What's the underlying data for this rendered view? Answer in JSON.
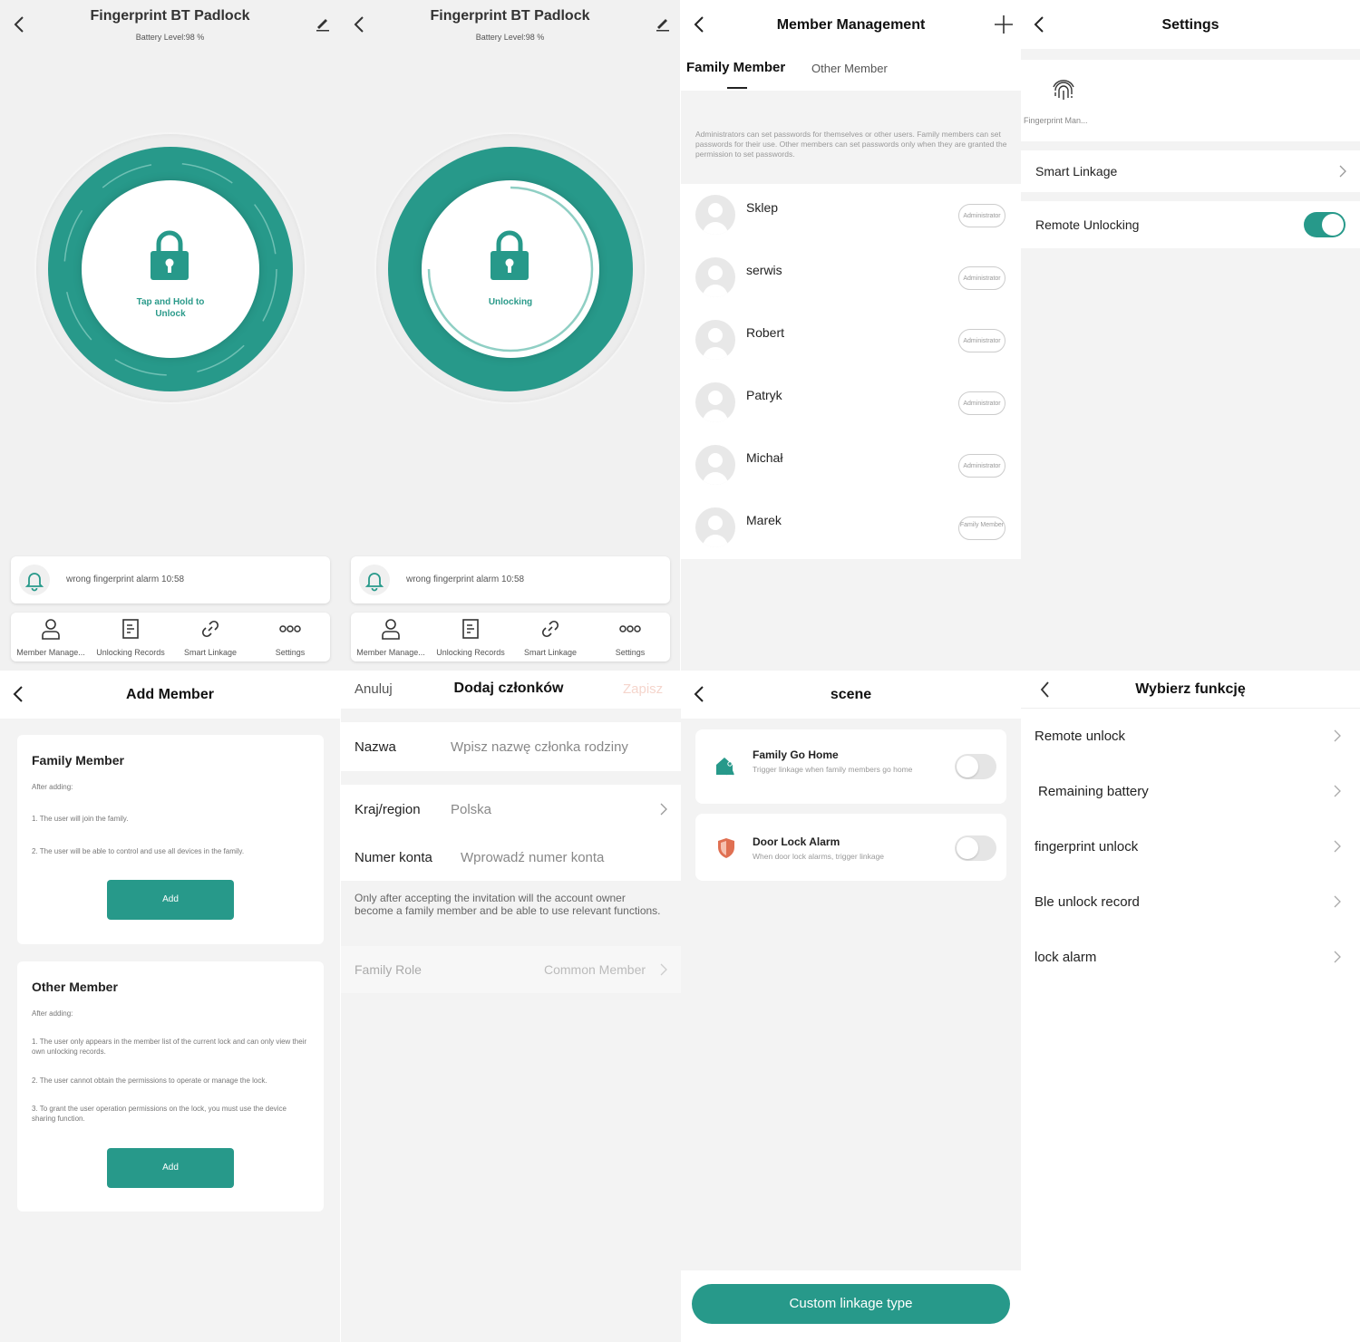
{
  "colors": {
    "accent": "#27998a",
    "background": "#f1f1f1",
    "danger": "#e07052"
  },
  "lock_screen_1": {
    "title": "Fingerprint BT Padlock",
    "battery": "Battery Level:98 %",
    "button_line1": "Tap and Hold to",
    "button_line2": "Unlock",
    "alarm": "wrong fingerprint alarm 10:58",
    "tabs": [
      {
        "label": "Member Manage...",
        "icon": "person-icon"
      },
      {
        "label": "Unlocking Records",
        "icon": "records-icon"
      },
      {
        "label": "Smart Linkage",
        "icon": "link-icon"
      },
      {
        "label": "Settings",
        "icon": "more-icon"
      }
    ]
  },
  "lock_screen_2": {
    "title": "Fingerprint BT Padlock",
    "battery": "Battery Level:98 %",
    "status": "Unlocking",
    "alarm": "wrong fingerprint alarm 10:58",
    "tabs": [
      {
        "label": "Member Manage...",
        "icon": "person-icon"
      },
      {
        "label": "Unlocking Records",
        "icon": "records-icon"
      },
      {
        "label": "Smart Linkage",
        "icon": "link-icon"
      },
      {
        "label": "Settings",
        "icon": "more-icon"
      }
    ]
  },
  "member_management": {
    "title": "Member Management",
    "tab_family": "Family Member",
    "tab_other": "Other Member",
    "info": "Administrators can set passwords for themselves or other users. Family members can set passwords for their use. Other members can set passwords only when they are granted the permission to set passwords.",
    "members": [
      {
        "name": "Sklep",
        "role": "Administrator"
      },
      {
        "name": "serwis",
        "role": "Administrator"
      },
      {
        "name": "Robert",
        "role": "Administrator"
      },
      {
        "name": "Patryk",
        "role": "Administrator"
      },
      {
        "name": "Michał",
        "role": "Administrator"
      },
      {
        "name": "Marek",
        "role": "Family Member"
      }
    ]
  },
  "settings": {
    "title": "Settings",
    "fingerprint_label": "Fingerprint Man...",
    "smart_linkage": "Smart Linkage",
    "remote_unlocking": "Remote Unlocking",
    "remote_unlocking_on": true
  },
  "add_member": {
    "title": "Add Member",
    "family": {
      "heading": "Family Member",
      "after": "After adding:",
      "points": [
        "1. The user will join the family.",
        "2. The user will be able to control and use all devices in the family."
      ],
      "button": "Add"
    },
    "other": {
      "heading": "Other Member",
      "after": "After adding:",
      "points": [
        "1. The user only appears in the member list of the current lock and can only view their own unlocking records.",
        "2. The user cannot obtain the permissions to operate or manage the lock.",
        "3. To grant the user operation permissions on the lock, you must use the device sharing function."
      ],
      "button": "Add"
    }
  },
  "dodaj": {
    "cancel": "Anuluj",
    "title": "Dodaj członków",
    "save": "Zapisz",
    "name_label": "Nazwa",
    "name_placeholder": "Wpisz nazwę członka rodziny",
    "country_label": "Kraj/region",
    "country_value": "Polska",
    "account_label": "Numer konta",
    "account_placeholder": "Wprowadź numer konta",
    "note": "Only after accepting the invitation will the account owner become a family member and be able to use relevant functions.",
    "role_label": "Family Role",
    "role_value": "Common Member"
  },
  "scene": {
    "title": "scene",
    "items": [
      {
        "title": "Family Go Home",
        "desc": "Trigger linkage when family members go home",
        "enabled": false
      },
      {
        "title": "Door Lock Alarm",
        "desc": "When door lock alarms, trigger linkage",
        "enabled": false
      }
    ],
    "button": "Custom linkage type"
  },
  "wybierz": {
    "title": "Wybierz funkcję",
    "items": [
      "Remote unlock",
      "Remaining battery",
      "fingerprint unlock",
      "Ble unlock record",
      "lock alarm"
    ]
  }
}
